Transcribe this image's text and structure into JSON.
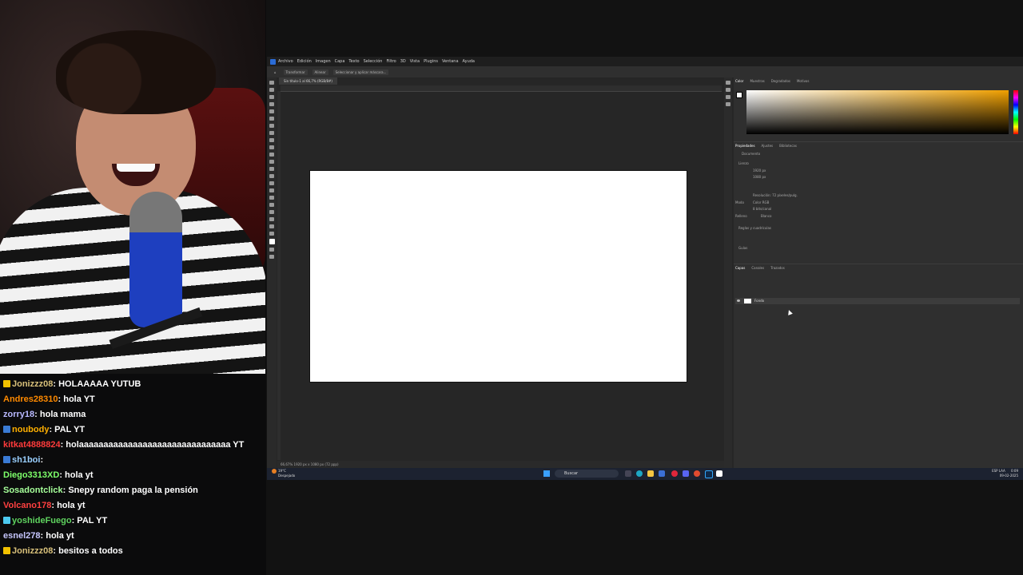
{
  "photoshop": {
    "menu": [
      "Archivo",
      "Edición",
      "Imagen",
      "Capa",
      "Texto",
      "Selección",
      "Filtro",
      "3D",
      "Vista",
      "Plugins",
      "Ventana",
      "Ayuda"
    ],
    "options": [
      "Transformar",
      "Alinear",
      "Seleccionar y aplicar máscara..."
    ],
    "doc_tab": "Sin título-1 al 66,7% (RGB/8#)",
    "status": "66,67%   1920 px x 1080 px (72 ppp)",
    "color_tabs": [
      "Color",
      "Muestras",
      "Degradados",
      "Motivos"
    ],
    "props_tabs": [
      "Propiedades",
      "Ajustes",
      "Bibliotecas"
    ],
    "props": {
      "doc": "Documento",
      "canvas": "Lienzo",
      "w": "1920 px",
      "h": "1080 px",
      "res": "Resolución: 72 píxeles/pulg.",
      "mode_label": "Modo",
      "mode": "Color RGB",
      "bits": "8 bits/canal",
      "fill_label": "Relleno",
      "fill": "Blanco",
      "rulers": "Reglas y cuadrículas",
      "guides": "Guías"
    },
    "layers_tabs": [
      "Capas",
      "Canales",
      "Trazados"
    ],
    "layer_name": "Fondo"
  },
  "chat": [
    {
      "user": "Jonizzz08",
      "text": "HOLAAAAA YUTUB",
      "color": "#d8c07a",
      "badge": "#f2c200"
    },
    {
      "user": "Andres28310",
      "text": "hola YT",
      "color": "#ff8a00",
      "badge": ""
    },
    {
      "user": "zorry18",
      "text": "hola mama",
      "color": "#b9b9ff",
      "badge": ""
    },
    {
      "user": "noubody",
      "text": "PAL YT",
      "color": "#ffb000",
      "badge": "#3a7bd5"
    },
    {
      "user": "kitkat4888824",
      "text": "holaaaaaaaaaaaaaaaaaaaaaaaaaaaaaaa YT",
      "color": "#ff3b3b",
      "badge": ""
    },
    {
      "user": "sh1boi",
      "text": "",
      "color": "#9ad0ff",
      "badge": "#3a7bd5"
    },
    {
      "user": "Diego3313XD",
      "text": "hola yt",
      "color": "#7dff6a",
      "badge": ""
    },
    {
      "user": "Sosadontclick",
      "text": "Snepy random paga la pensión",
      "color": "#a6ff9a",
      "badge": ""
    },
    {
      "user": "Volcano178",
      "text": "hola yt",
      "color": "#ff4040",
      "badge": ""
    },
    {
      "user": "yoshideFuego",
      "text": "PAL YT",
      "color": "#5fd35f",
      "badge": "#4cc9f0"
    },
    {
      "user": "esnel278",
      "text": "hola yt",
      "color": "#c7c7ff",
      "badge": ""
    },
    {
      "user": "Jonizzz08",
      "text": "besitos a todos",
      "color": "#d8c07a",
      "badge": "#f2c200"
    }
  ],
  "taskbar": {
    "weather_temp": "19°C",
    "weather_desc": "Despejado",
    "search": "Buscar",
    "lang": "ESP LAA",
    "time": "0:09",
    "date": "09-02-2025"
  }
}
